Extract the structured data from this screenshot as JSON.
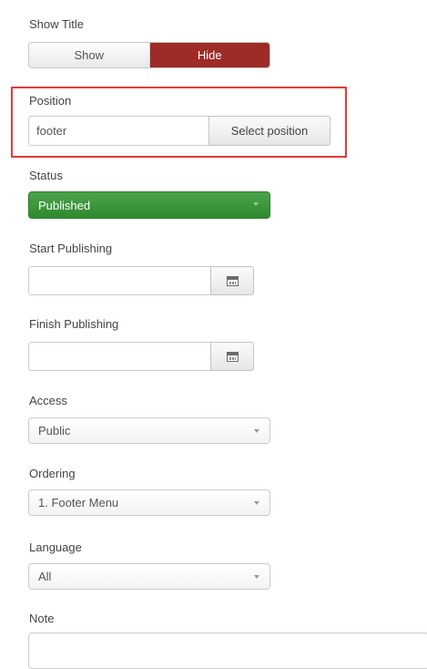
{
  "show_title": {
    "label": "Show Title",
    "options": [
      "Show",
      "Hide"
    ],
    "selected": "Hide"
  },
  "position": {
    "label": "Position",
    "value": "footer",
    "button_label": "Select position"
  },
  "status": {
    "label": "Status",
    "value": "Published"
  },
  "start_publishing": {
    "label": "Start Publishing",
    "value": ""
  },
  "finish_publishing": {
    "label": "Finish Publishing",
    "value": ""
  },
  "access": {
    "label": "Access",
    "value": "Public"
  },
  "ordering": {
    "label": "Ordering",
    "value": "1. Footer Menu"
  },
  "language": {
    "label": "Language",
    "value": "All"
  },
  "note": {
    "label": "Note",
    "value": ""
  },
  "icons": {
    "calendar": "calendar-icon",
    "dropdown_caret": "chevron-down-icon"
  },
  "colors": {
    "hide_active": "#9e2b26",
    "status_published": "#3a963a",
    "highlight_border": "#e53935"
  }
}
